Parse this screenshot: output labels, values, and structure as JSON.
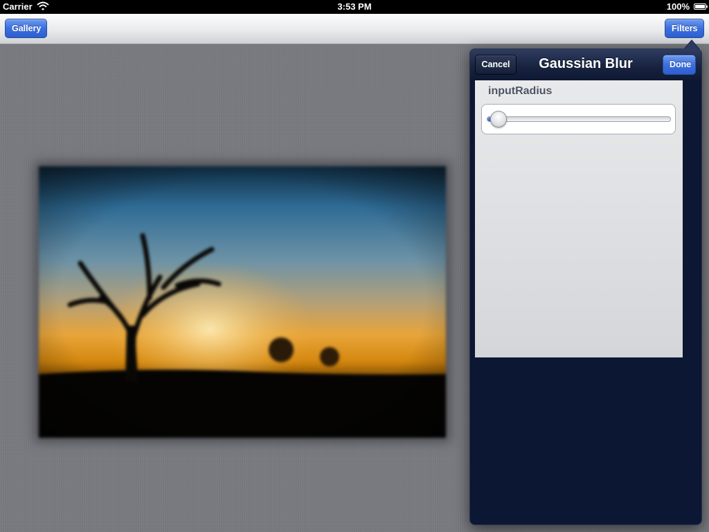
{
  "status_bar": {
    "carrier": "Carrier",
    "time": "3:53 PM",
    "battery": "100%",
    "icons": [
      "wifi-icon",
      "battery-icon"
    ]
  },
  "toolbar": {
    "left_button": "Gallery",
    "right_button": "Filters"
  },
  "photo": {
    "description_icon": "blurred-sunset-tree-photo"
  },
  "popover": {
    "title": "Gaussian Blur",
    "cancel_label": "Cancel",
    "done_label": "Done",
    "parameters": [
      {
        "label": "inputRadius",
        "value_fraction": 0.02
      }
    ]
  },
  "colors": {
    "accent_blue": "#3c6edd",
    "popover_bg": "#0c1733",
    "canvas_bg": "#797a80"
  }
}
